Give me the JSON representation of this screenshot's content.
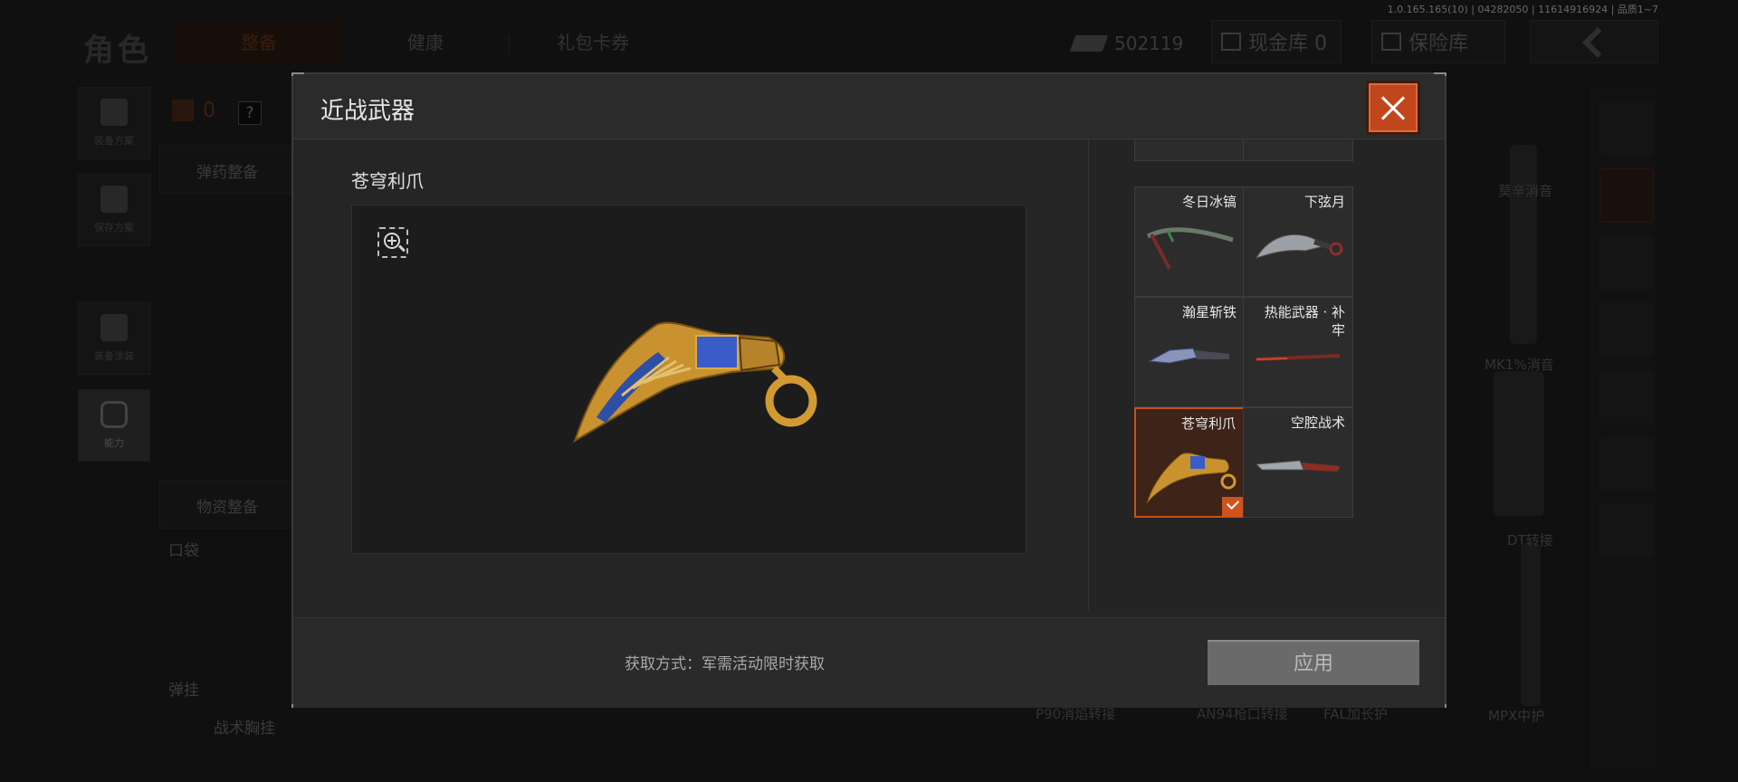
{
  "background": {
    "build_info": "1.0.165.165(10) | 04282050 | 11614916924 | 品质1~7",
    "page_title": "角色",
    "tabs": [
      {
        "label": "整备"
      },
      {
        "label": "健康"
      },
      {
        "label": "礼包卡券"
      }
    ],
    "currency_amount": "502119",
    "cash_vault_label": "现金库 0",
    "vault_label": "保险库",
    "loadout_count": "0",
    "help_glyph": "?",
    "side_buttons": [
      {
        "label": "装备方案"
      },
      {
        "label": "保存方案"
      },
      {
        "label": "装备涂装"
      },
      {
        "label": "能力"
      }
    ],
    "sections": {
      "ammo": "弹药整备",
      "supplies": "物资整备",
      "pocket": "口袋",
      "sling": "弹挂",
      "chest_rig": "战术胸挂"
    },
    "attachments": [
      {
        "label": "莫辛消音"
      },
      {
        "label": "MK1%消音"
      },
      {
        "label": "DT转接"
      },
      {
        "label": "MPX中护"
      },
      {
        "label": "P90消焰转接"
      },
      {
        "label": "AN94枪口转接"
      },
      {
        "label": "FAL加长护"
      }
    ]
  },
  "modal": {
    "title": "近战武器",
    "selected_item_name": "苍穹利爪",
    "acquire_text": "获取方式：军需活动限时获取",
    "apply_label": "应用",
    "items": [
      {
        "name": "冬日冰镐",
        "icon": "ice-pickaxe-icon",
        "selected": false
      },
      {
        "name": "下弦月",
        "icon": "karambit-icon",
        "selected": false
      },
      {
        "name": "瀚星斩铁",
        "icon": "tanto-icon",
        "selected": false
      },
      {
        "name": "热能武器 · 补牢",
        "icon": "thermal-blade-icon",
        "selected": false
      },
      {
        "name": "苍穹利爪",
        "icon": "claw-karambit-icon",
        "selected": true
      },
      {
        "name": "空腔战术",
        "icon": "tactical-knife-icon",
        "selected": false
      }
    ]
  },
  "colors": {
    "accent": "#c8501c",
    "close_button": "#c2461b",
    "apply_disabled": "#6a6a6a"
  }
}
